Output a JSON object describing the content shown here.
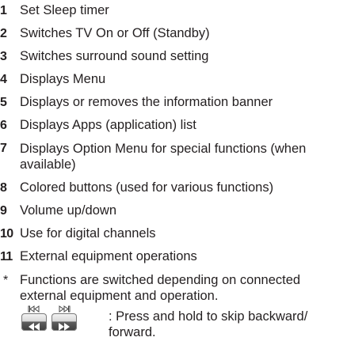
{
  "items": [
    {
      "num": "1",
      "text": "Set Sleep timer"
    },
    {
      "num": "2",
      "text": "Switches TV On or Off (Standby)"
    },
    {
      "num": "3",
      "text": "Switches surround sound setting"
    },
    {
      "num": "4",
      "text": "Displays Menu"
    },
    {
      "num": "5",
      "text": "Displays or removes the information banner"
    },
    {
      "num": "6",
      "text": "Displays Apps (application) list"
    },
    {
      "num": "7",
      "text": "Displays Option Menu for special functions (when available)"
    },
    {
      "num": "8",
      "text": "Colored buttons (used for various functions)"
    },
    {
      "num": "9",
      "text": "Volume up/down"
    },
    {
      "num": "10",
      "text": "Use for digital channels"
    },
    {
      "num": "11",
      "text": "External equipment operations"
    }
  ],
  "note": {
    "marker": "*",
    "text": "Functions are switched depending on connected external equipment and operation."
  },
  "skip": {
    "text": ": Press and hold to skip backward/ forward.",
    "icons": [
      "skip-backward-icon",
      "skip-forward-icon"
    ]
  }
}
